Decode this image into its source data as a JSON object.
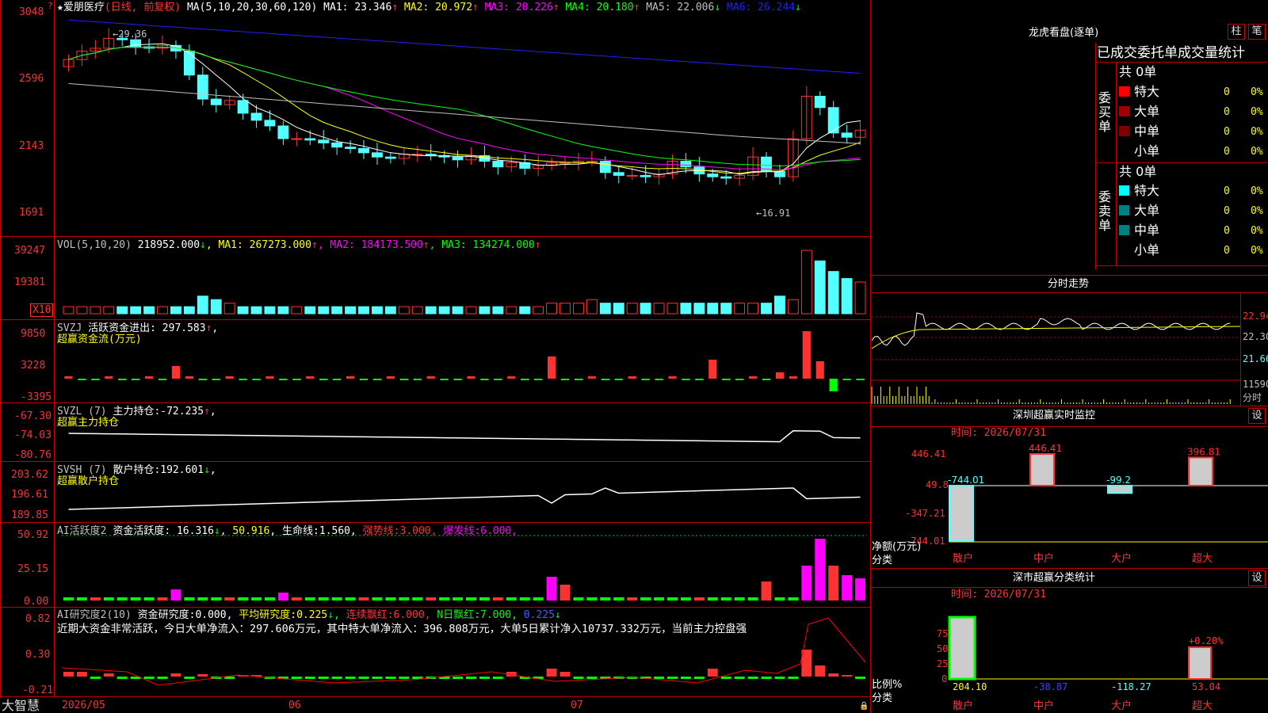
{
  "stock": {
    "name": "★爱朋医疗",
    "period": "(日线, 前复权)"
  },
  "colors": {
    "up": "#ff3232",
    "down": "#54ffff",
    "ma1": "#ffffff",
    "ma2": "#ffff00",
    "ma3": "#ff00ff",
    "ma4": "#00ff00",
    "ma5": "#c0c0c0",
    "ma6": "#2020ff",
    "border": "#c00000"
  },
  "price_panel": {
    "header_label": "MA(5,10,20,30,60,120)",
    "ma_values": [
      {
        "label": "MA1:",
        "value": "23.346",
        "arrow": "↑",
        "color": "#ffffff"
      },
      {
        "label": "MA2:",
        "value": "20.972",
        "arrow": "↑",
        "color": "#ffff00"
      },
      {
        "label": "MA3:",
        "value": "20.226",
        "arrow": "↑",
        "color": "#ff00ff"
      },
      {
        "label": "MA4:",
        "value": "20.180",
        "arrow": "↑",
        "color": "#00ff00"
      },
      {
        "label": "MA5:",
        "value": "22.006",
        "arrow": "↓",
        "color": "#c0c0c0"
      },
      {
        "label": "MA6:",
        "value": "26.244",
        "arrow": "↓",
        "color": "#2020ff"
      }
    ],
    "y_ticks": [
      "3048",
      "2596",
      "2143",
      "1691"
    ],
    "high_label": "29.36",
    "low_label": "16.91"
  },
  "vol_panel": {
    "header": "VOL(5,10,20)",
    "value": "218952.000",
    "value_arrow": "↓",
    "ma": [
      {
        "label": "MA1:",
        "value": "267273.000",
        "arrow": "↑",
        "color": "#ffff00"
      },
      {
        "label": "MA2:",
        "value": "184173.500",
        "arrow": "↑",
        "color": "#ff00ff"
      },
      {
        "label": "MA3:",
        "value": "134274.000",
        "arrow": "↑",
        "color": "#00ff00"
      }
    ],
    "y_ticks": [
      "39247",
      "19381"
    ],
    "unit_badge": "X10"
  },
  "svzj_panel": {
    "header": "SVZJ",
    "label": "活跃资金进出:",
    "value": "297.583",
    "arrow": "↑",
    "subtitle": "超赢资金流(万元)",
    "y_ticks": [
      "9850",
      "3228",
      "-3395"
    ]
  },
  "svzl_panel": {
    "header": "SVZL (7)",
    "label": "主力持仓:",
    "value": "-72.235",
    "arrow": "↑",
    "subtitle": "超赢主力持仓",
    "y_ticks": [
      "-67.30",
      "-74.03",
      "-80.76"
    ]
  },
  "svsh_panel": {
    "header": "SVSH (7)",
    "label": "散户持仓:",
    "value": "192.601",
    "arrow": "↓",
    "subtitle": "超赢散户持仓",
    "y_ticks": [
      "203.62",
      "196.61",
      "189.85"
    ]
  },
  "ai_active_panel": {
    "header": "AI活跃度2",
    "label": "资金活跃度:",
    "value": "16.316",
    "arrow": "↓",
    "v2": "50.916",
    "life_label": "生命线:",
    "life_value": "1.560",
    "strong_label": "强势线:",
    "strong_value": "3.000",
    "burst_label": "爆发线:",
    "burst_value": "6.000",
    "y_ticks": [
      "50.92",
      "25.15",
      "0.00"
    ]
  },
  "ai_research_panel": {
    "header": "AI研究度2(10)",
    "label": "资金研究度:",
    "value": "0.000",
    "avg_label": "平均研究度:",
    "avg_value": "0.225",
    "cont_label": "连续飘红:",
    "cont_value": "6.000",
    "n_label": "N日飘红:",
    "n_value": "7.000",
    "last_value": "0.225",
    "comment": "近期大资金非常活跃，今日大单净流入：297.606万元，其中特大单净流入：396.808万元，大单5日累计净入10737.332万元，当前主力控盘强",
    "y_ticks": [
      "0.82",
      "0.30",
      "-0.21"
    ]
  },
  "x_axis": {
    "labels": [
      "2026/05",
      "06",
      "07"
    ]
  },
  "footer": {
    "brand": "大智慧"
  },
  "dragon_tiger": {
    "title": "龙虎看盘(逐单)",
    "btn_col": "柱",
    "btn_pen": "笔",
    "tabs_text": "已成交委托单成交量统计",
    "buy_side": {
      "label": "委买单",
      "total": "共 0单",
      "rows": [
        {
          "name": "特大",
          "count": "0",
          "pct": "0%",
          "color": "#ff0000"
        },
        {
          "name": "大单",
          "count": "0",
          "pct": "0%",
          "color": "#a00000"
        },
        {
          "name": "中单",
          "count": "0",
          "pct": "0%",
          "color": "#800000"
        },
        {
          "name": "小单",
          "count": "0",
          "pct": "0%",
          "color": ""
        }
      ]
    },
    "sell_side": {
      "label": "委卖单",
      "total": "共 0单",
      "rows": [
        {
          "name": "特大",
          "count": "0",
          "pct": "0%",
          "color": "#00ffff"
        },
        {
          "name": "大单",
          "count": "0",
          "pct": "0%",
          "color": "#008080"
        },
        {
          "name": "中单",
          "count": "0",
          "pct": "0%",
          "color": "#008080"
        },
        {
          "name": "小单",
          "count": "0",
          "pct": "0%",
          "color": ""
        }
      ]
    }
  },
  "intraday": {
    "title": "分时走势",
    "y_ticks": [
      "22.94",
      "22.30",
      "21.66"
    ],
    "vol_tick": "11590",
    "vol_label": "分时"
  },
  "sz_monitor": {
    "title": "深圳超赢实时监控",
    "btn": "设",
    "time_label": "时间: 2026/07/31",
    "y_ticks": [
      "446.41",
      "49.8",
      "-347.21",
      "-744.01"
    ],
    "axis_label_1": "净额(万元)",
    "axis_label_2": "分类",
    "bars": [
      {
        "cat": "散户",
        "value": -744.01,
        "label": "-744.01"
      },
      {
        "cat": "中户",
        "value": 446.41,
        "label": "446.41"
      },
      {
        "cat": "大户",
        "value": -99.2,
        "label": "-99.2"
      },
      {
        "cat": "超大",
        "value": 396.81,
        "label": "396.81"
      }
    ]
  },
  "sz_stats": {
    "title": "深市超赢分类统计",
    "btn": "设",
    "time_label": "时间: 2026/07/31",
    "y_ticks": [
      "75",
      "50",
      "25",
      "0"
    ],
    "axis_label_1": "比例%",
    "axis_label_2": "分类",
    "values": [
      {
        "cat": "散户",
        "label": "204.10",
        "color": "#ffff00"
      },
      {
        "cat": "中户",
        "label": "-38.87",
        "color": "#4040ff"
      },
      {
        "cat": "大户",
        "label": "-118.27",
        "color": "#54ffff"
      },
      {
        "cat": "超大",
        "label": "53.04",
        "color": "#ff3232"
      }
    ],
    "annot": "+0.20%"
  }
}
